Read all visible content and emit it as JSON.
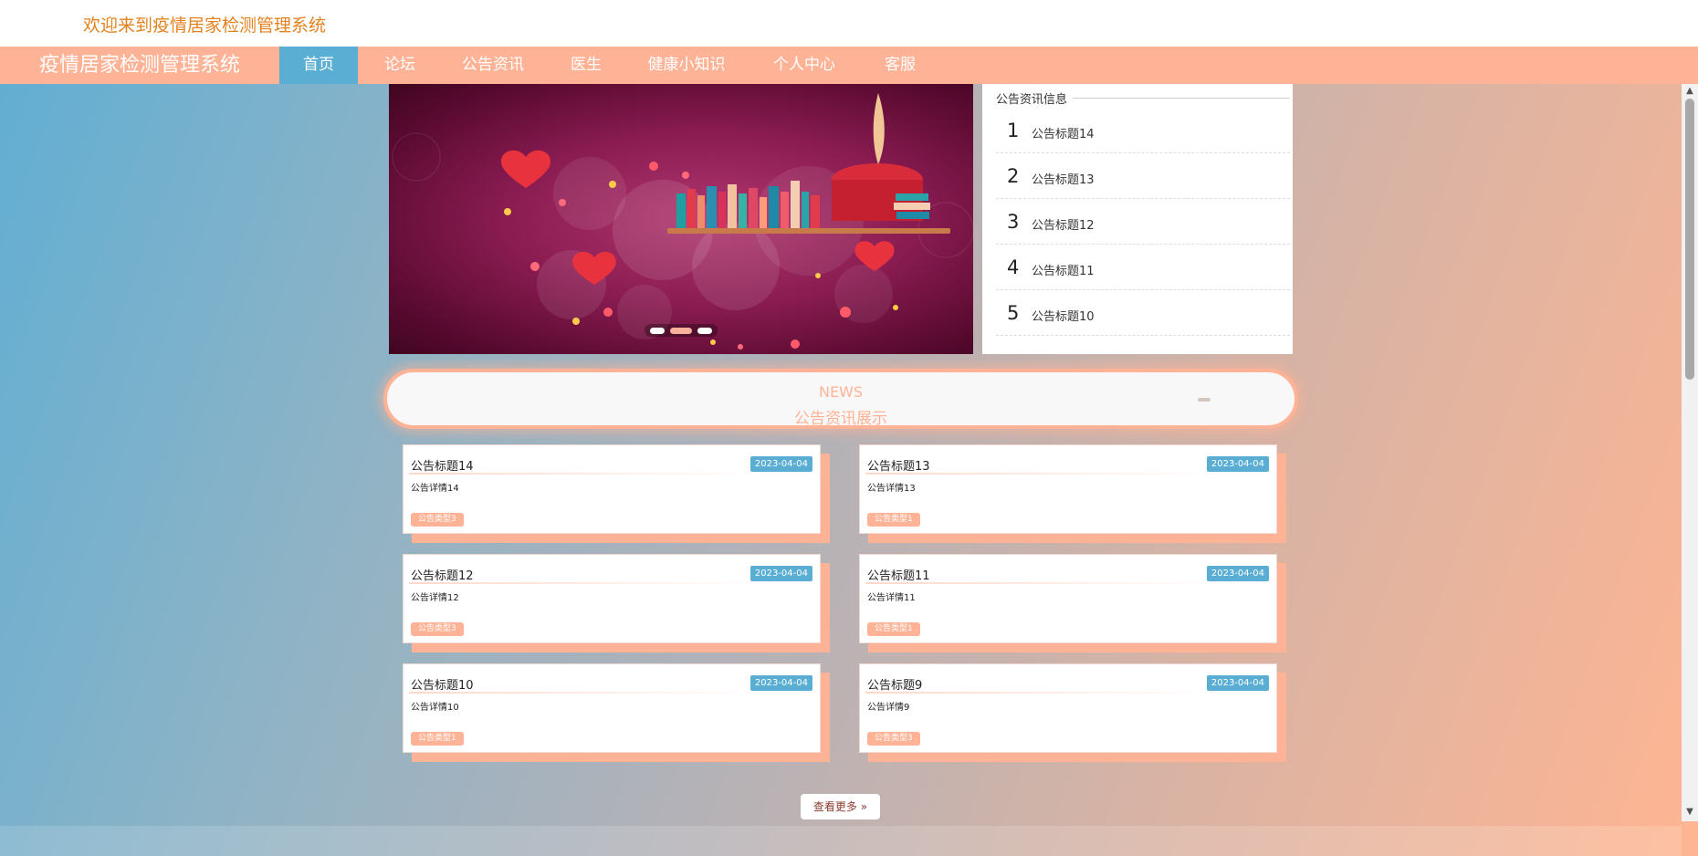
{
  "header": {
    "welcome": "欢迎来到疫情居家检测管理系统"
  },
  "nav": {
    "brand": "疫情居家检测管理系统",
    "items": [
      {
        "label": "首页",
        "active": true
      },
      {
        "label": "论坛"
      },
      {
        "label": "公告资讯"
      },
      {
        "label": "医生"
      },
      {
        "label": "健康小知识"
      },
      {
        "label": "个人中心"
      },
      {
        "label": "客服"
      }
    ]
  },
  "carousel": {
    "slide_count": 3,
    "active_index": 1
  },
  "notices": {
    "title": "公告资讯信息",
    "items": [
      {
        "num": "1",
        "text": "公告标题14"
      },
      {
        "num": "2",
        "text": "公告标题13"
      },
      {
        "num": "3",
        "text": "公告标题12"
      },
      {
        "num": "4",
        "text": "公告标题11"
      },
      {
        "num": "5",
        "text": "公告标题10"
      }
    ]
  },
  "news": {
    "en_title": "NEWS",
    "cn_title": "公告资讯展示",
    "cards": [
      {
        "title": "公告标题14",
        "date": "2023-04-04",
        "desc": "公告详情14",
        "tag": "公告类型3"
      },
      {
        "title": "公告标题13",
        "date": "2023-04-04",
        "desc": "公告详情13",
        "tag": "公告类型1"
      },
      {
        "title": "公告标题12",
        "date": "2023-04-04",
        "desc": "公告详情12",
        "tag": "公告类型3"
      },
      {
        "title": "公告标题11",
        "date": "2023-04-04",
        "desc": "公告详情11",
        "tag": "公告类型1"
      },
      {
        "title": "公告标题10",
        "date": "2023-04-04",
        "desc": "公告详情10",
        "tag": "公告类型1"
      },
      {
        "title": "公告标题9",
        "date": "2023-04-04",
        "desc": "公告详情9",
        "tag": "公告类型3"
      }
    ],
    "more_label": "查看更多 »"
  },
  "colors": {
    "accent": "#ffb396",
    "active_nav": "#5aaed4",
    "welcome": "#e3821f"
  }
}
